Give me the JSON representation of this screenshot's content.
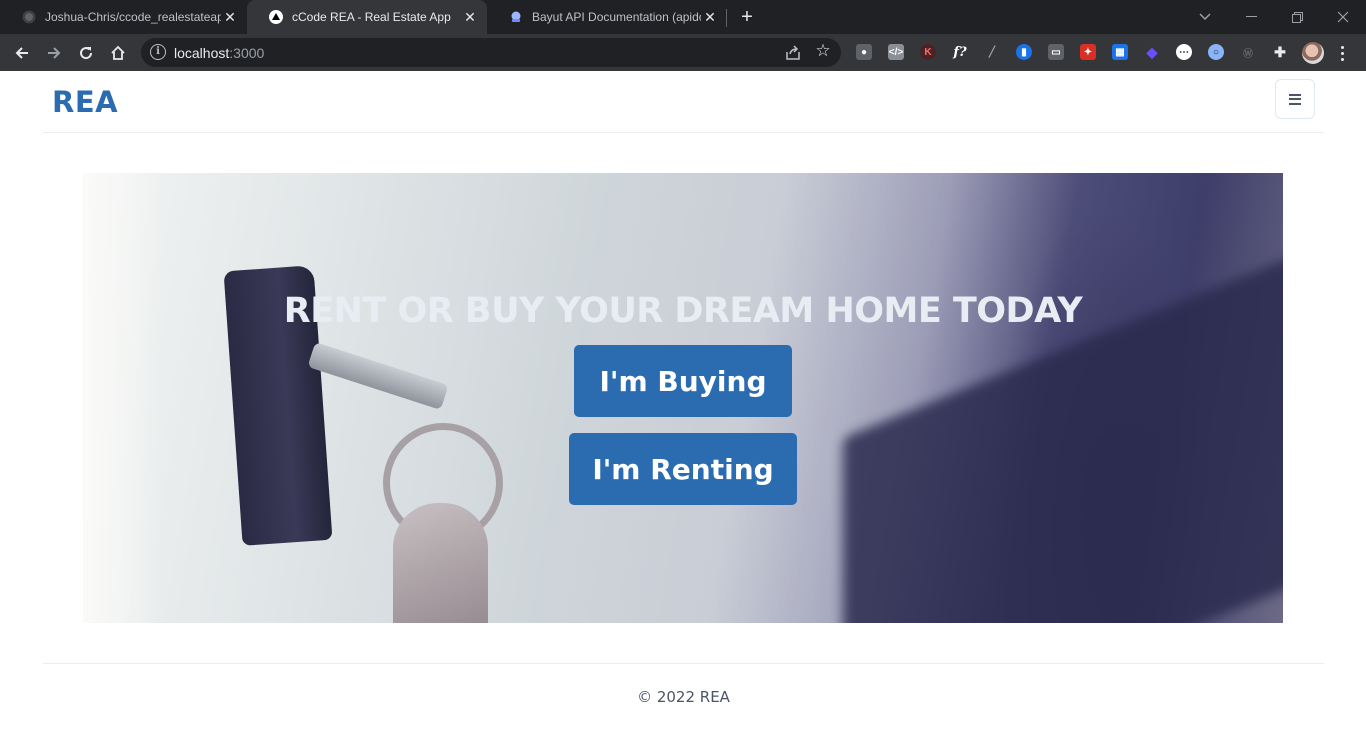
{
  "browser": {
    "tabs": [
      {
        "title": "Joshua-Chris/ccode_realestateap",
        "favicon": "github-icon",
        "active": false
      },
      {
        "title": "cCode REA - Real Estate App",
        "favicon": "nextjs-icon",
        "active": true
      },
      {
        "title": "Bayut API Documentation (apido",
        "favicon": "rapidapi-icon",
        "active": false
      }
    ],
    "address_host": "localhost",
    "address_port": ":3000"
  },
  "navbar": {
    "brand": "REA",
    "menu_icon": "hamburger-icon"
  },
  "hero": {
    "title": "RENT OR BUY YOUR DREAM HOME TODAY",
    "buy_label": "I'm Buying",
    "rent_label": "I'm Renting",
    "button_color": "#2b6cb0"
  },
  "footer": {
    "copyright": "© 2022 REA"
  },
  "colors": {
    "brand": "#2b6cb0",
    "browser_frame": "#202124",
    "browser_toolbar": "#35363a"
  }
}
